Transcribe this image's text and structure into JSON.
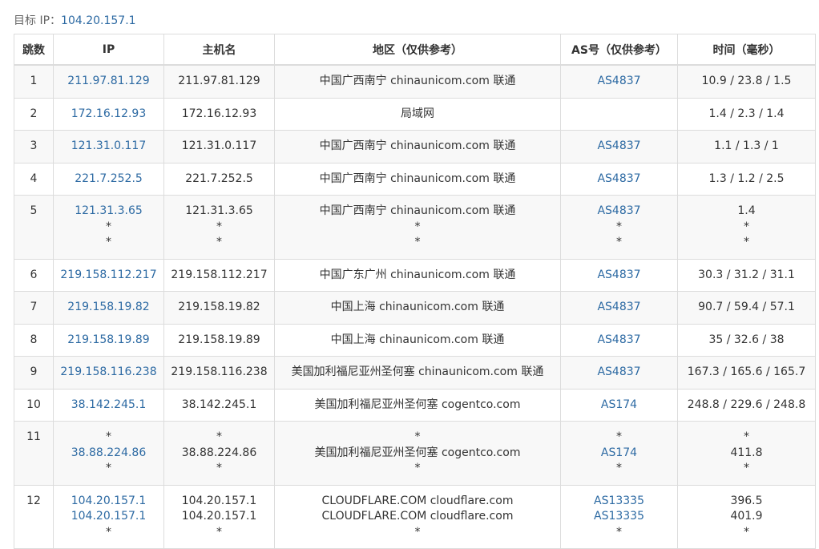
{
  "target": {
    "label": "目标 IP：",
    "ip": "104.20.157.1"
  },
  "columns": [
    "跳数",
    "IP",
    "主机名",
    "地区（仅供参考）",
    "AS号（仅供参考）",
    "时间（毫秒）"
  ],
  "rows": [
    {
      "hop": "1",
      "ips": [
        "211.97.81.129"
      ],
      "hosts": [
        "211.97.81.129"
      ],
      "regions": [
        "中国广西南宁 chinaunicom.com 联通"
      ],
      "as": [
        "AS4837"
      ],
      "times": [
        "10.9 / 23.8 / 1.5"
      ]
    },
    {
      "hop": "2",
      "ips": [
        "172.16.12.93"
      ],
      "hosts": [
        "172.16.12.93"
      ],
      "regions": [
        "局域网"
      ],
      "as": [
        ""
      ],
      "times": [
        "1.4 / 2.3 / 1.4"
      ]
    },
    {
      "hop": "3",
      "ips": [
        "121.31.0.117"
      ],
      "hosts": [
        "121.31.0.117"
      ],
      "regions": [
        "中国广西南宁 chinaunicom.com 联通"
      ],
      "as": [
        "AS4837"
      ],
      "times": [
        "1.1 / 1.3 / 1"
      ]
    },
    {
      "hop": "4",
      "ips": [
        "221.7.252.5"
      ],
      "hosts": [
        "221.7.252.5"
      ],
      "regions": [
        "中国广西南宁 chinaunicom.com 联通"
      ],
      "as": [
        "AS4837"
      ],
      "times": [
        "1.3 / 1.2 / 2.5"
      ]
    },
    {
      "hop": "5",
      "ips": [
        "121.31.3.65",
        "*",
        "*"
      ],
      "hosts": [
        "121.31.3.65",
        "*",
        "*"
      ],
      "regions": [
        "中国广西南宁 chinaunicom.com 联通",
        "*",
        "*"
      ],
      "as": [
        "AS4837",
        "*",
        "*"
      ],
      "times": [
        "1.4",
        "*",
        "*"
      ]
    },
    {
      "hop": "6",
      "ips": [
        "219.158.112.217"
      ],
      "hosts": [
        "219.158.112.217"
      ],
      "regions": [
        "中国广东广州 chinaunicom.com 联通"
      ],
      "as": [
        "AS4837"
      ],
      "times": [
        "30.3 / 31.2 / 31.1"
      ]
    },
    {
      "hop": "7",
      "ips": [
        "219.158.19.82"
      ],
      "hosts": [
        "219.158.19.82"
      ],
      "regions": [
        "中国上海 chinaunicom.com 联通"
      ],
      "as": [
        "AS4837"
      ],
      "times": [
        "90.7 / 59.4 / 57.1"
      ]
    },
    {
      "hop": "8",
      "ips": [
        "219.158.19.89"
      ],
      "hosts": [
        "219.158.19.89"
      ],
      "regions": [
        "中国上海 chinaunicom.com 联通"
      ],
      "as": [
        "AS4837"
      ],
      "times": [
        "35 / 32.6 / 38"
      ]
    },
    {
      "hop": "9",
      "ips": [
        "219.158.116.238"
      ],
      "hosts": [
        "219.158.116.238"
      ],
      "regions": [
        "美国加利福尼亚州圣何塞 chinaunicom.com 联通"
      ],
      "as": [
        "AS4837"
      ],
      "times": [
        "167.3 / 165.6 / 165.7"
      ]
    },
    {
      "hop": "10",
      "ips": [
        "38.142.245.1"
      ],
      "hosts": [
        "38.142.245.1"
      ],
      "regions": [
        "美国加利福尼亚州圣何塞 cogentco.com"
      ],
      "as": [
        "AS174"
      ],
      "times": [
        "248.8 / 229.6 / 248.8"
      ]
    },
    {
      "hop": "11",
      "ips": [
        "*",
        "38.88.224.86",
        "*"
      ],
      "hosts": [
        "*",
        "38.88.224.86",
        "*"
      ],
      "regions": [
        "*",
        "美国加利福尼亚州圣何塞 cogentco.com",
        "*"
      ],
      "as": [
        "*",
        "AS174",
        "*"
      ],
      "times": [
        "*",
        "411.8",
        "*"
      ]
    },
    {
      "hop": "12",
      "ips": [
        "104.20.157.1",
        "104.20.157.1",
        "*"
      ],
      "hosts": [
        "104.20.157.1",
        "104.20.157.1",
        "*"
      ],
      "regions": [
        "CLOUDFLARE.COM cloudflare.com",
        "CLOUDFLARE.COM cloudflare.com",
        "*"
      ],
      "as": [
        "AS13335",
        "AS13335",
        "*"
      ],
      "times": [
        "396.5",
        "401.9",
        "*"
      ]
    }
  ]
}
